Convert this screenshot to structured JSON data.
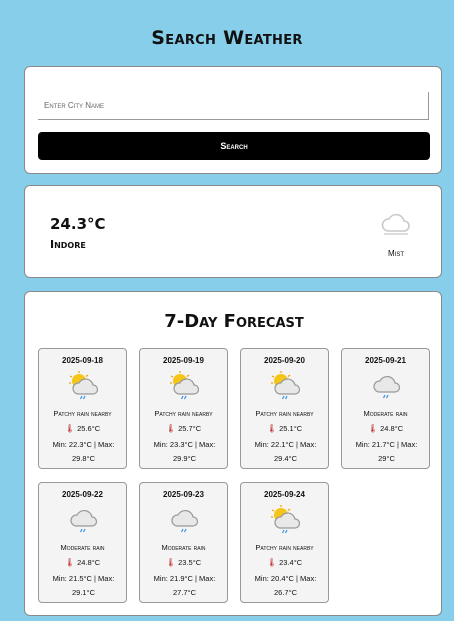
{
  "page": {
    "title": "Search Weather"
  },
  "search": {
    "placeholder": "Enter City Name",
    "value": "",
    "button_label": "Search"
  },
  "current": {
    "temperature": "24.3°C",
    "city": "Indore",
    "description": "Mist",
    "icon": "cloud-icon"
  },
  "forecast": {
    "title": "7-Day Forecast",
    "days": [
      {
        "date": "2025-09-18",
        "icon": "sun-cloud-rain-icon",
        "description": "Patchy rain nearby",
        "avg": "25.6°C",
        "minmax": "Min: 22.3°C | Max: 29.8°C"
      },
      {
        "date": "2025-09-19",
        "icon": "sun-cloud-rain-icon",
        "description": "Patchy rain nearby",
        "avg": "25.7°C",
        "minmax": "Min: 23.3°C | Max: 29.9°C"
      },
      {
        "date": "2025-09-20",
        "icon": "sun-cloud-rain-icon",
        "description": "Patchy rain nearby",
        "avg": "25.1°C",
        "minmax": "Min: 22.1°C | Max: 29.4°C"
      },
      {
        "date": "2025-09-21",
        "icon": "cloud-rain-icon",
        "description": "Moderate rain",
        "avg": "24.8°C",
        "minmax": "Min: 21.7°C | Max: 29°C"
      },
      {
        "date": "2025-09-22",
        "icon": "cloud-rain-icon",
        "description": "Moderate rain",
        "avg": "24.8°C",
        "minmax": "Min: 21.5°C | Max: 29.1°C"
      },
      {
        "date": "2025-09-23",
        "icon": "cloud-rain-icon",
        "description": "Moderate rain",
        "avg": "23.5°C",
        "minmax": "Min: 21.9°C | Max: 27.7°C"
      },
      {
        "date": "2025-09-24",
        "icon": "sun-cloud-rain-icon",
        "description": "Patchy rain nearby",
        "avg": "23.4°C",
        "minmax": "Min: 20.4°C | Max: 26.7°C"
      }
    ]
  },
  "colors": {
    "background": "#87ceeb",
    "button": "#000000",
    "card": "#ffffff",
    "forecast_tile": "#f4f4f4",
    "sun": "#f5c518",
    "cloud": "#b0b0b0",
    "rain": "#3a8ee6"
  }
}
